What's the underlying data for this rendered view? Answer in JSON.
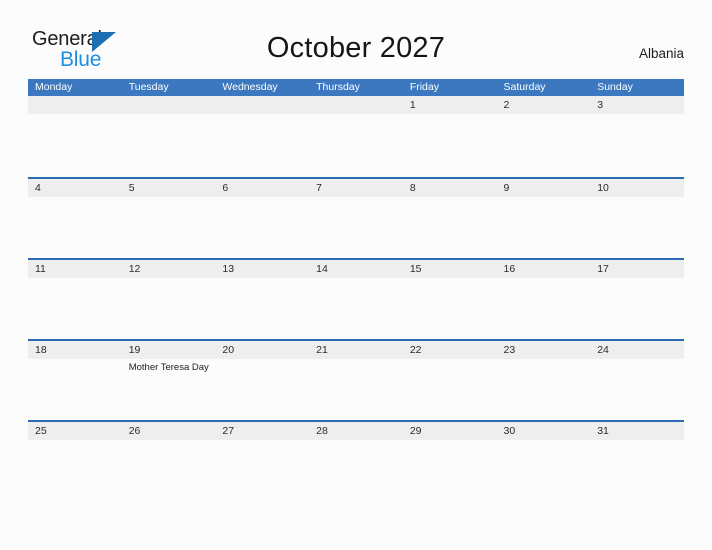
{
  "brand": {
    "word_top": "General",
    "word_bottom": "Blue",
    "triangle_color": "#1f6db5",
    "blue_text_color": "#1f8fe0"
  },
  "header": {
    "title": "October 2027",
    "locale": "Albania"
  },
  "theme": {
    "header_blue": "#3b78bf",
    "rule_blue": "#2a6cb0",
    "date_band_gray": "#eeeeee",
    "page_background": "#fcfcfc"
  },
  "calendar": {
    "month": "October",
    "year": "2027",
    "weekday_headers": [
      "Monday",
      "Tuesday",
      "Wednesday",
      "Thursday",
      "Friday",
      "Saturday",
      "Sunday"
    ],
    "weeks": [
      {
        "days": [
          {
            "date": "",
            "events": []
          },
          {
            "date": "",
            "events": []
          },
          {
            "date": "",
            "events": []
          },
          {
            "date": "",
            "events": []
          },
          {
            "date": "1",
            "events": []
          },
          {
            "date": "2",
            "events": []
          },
          {
            "date": "3",
            "events": []
          }
        ]
      },
      {
        "days": [
          {
            "date": "4",
            "events": []
          },
          {
            "date": "5",
            "events": []
          },
          {
            "date": "6",
            "events": []
          },
          {
            "date": "7",
            "events": []
          },
          {
            "date": "8",
            "events": []
          },
          {
            "date": "9",
            "events": []
          },
          {
            "date": "10",
            "events": []
          }
        ]
      },
      {
        "days": [
          {
            "date": "11",
            "events": []
          },
          {
            "date": "12",
            "events": []
          },
          {
            "date": "13",
            "events": []
          },
          {
            "date": "14",
            "events": []
          },
          {
            "date": "15",
            "events": []
          },
          {
            "date": "16",
            "events": []
          },
          {
            "date": "17",
            "events": []
          }
        ]
      },
      {
        "days": [
          {
            "date": "18",
            "events": []
          },
          {
            "date": "19",
            "events": [
              "Mother Teresa Day"
            ]
          },
          {
            "date": "20",
            "events": []
          },
          {
            "date": "21",
            "events": []
          },
          {
            "date": "22",
            "events": []
          },
          {
            "date": "23",
            "events": []
          },
          {
            "date": "24",
            "events": []
          }
        ]
      },
      {
        "days": [
          {
            "date": "25",
            "events": []
          },
          {
            "date": "26",
            "events": []
          },
          {
            "date": "27",
            "events": []
          },
          {
            "date": "28",
            "events": []
          },
          {
            "date": "29",
            "events": []
          },
          {
            "date": "30",
            "events": []
          },
          {
            "date": "31",
            "events": []
          }
        ]
      }
    ]
  }
}
